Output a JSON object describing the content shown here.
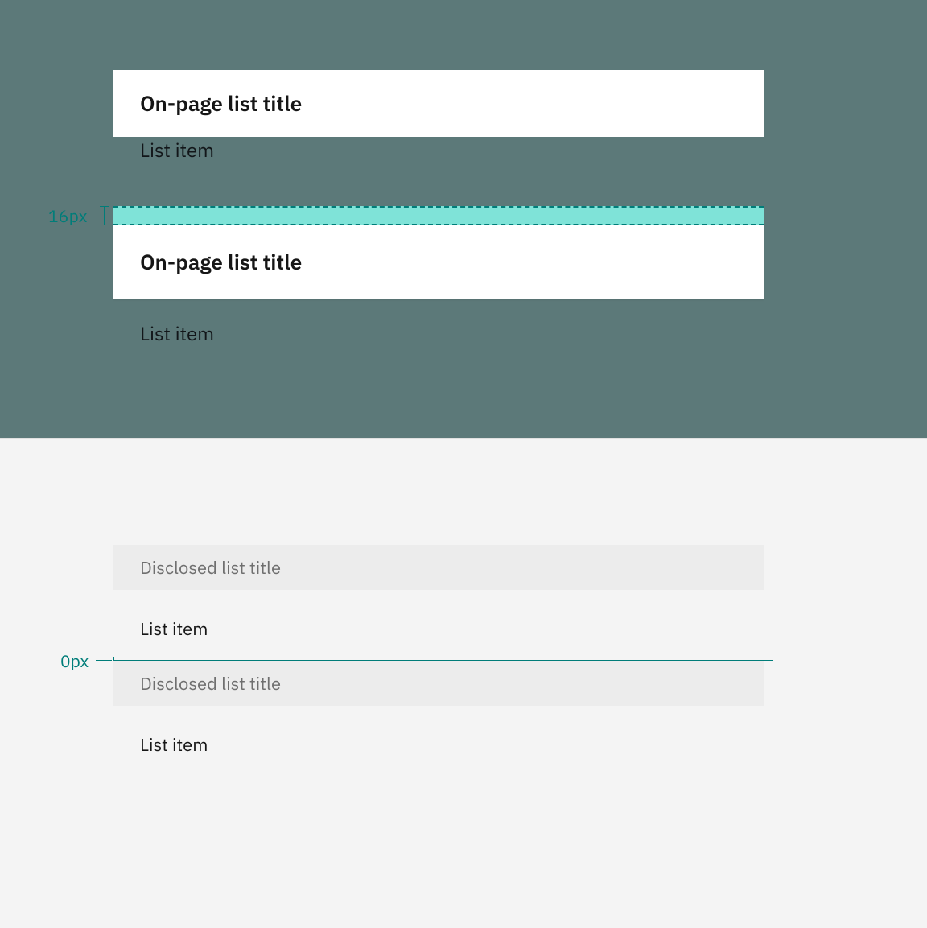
{
  "top_panel": {
    "group1": {
      "title": "On-page list title",
      "item": "List item"
    },
    "spacing_label": "16px",
    "group2": {
      "title": "On-page list title",
      "item": "List item"
    }
  },
  "bottom_panel": {
    "group1": {
      "title": "Disclosed list title",
      "item": "List item"
    },
    "spacing_label": "0px",
    "group2": {
      "title": "Disclosed list title",
      "item": "List item"
    }
  }
}
